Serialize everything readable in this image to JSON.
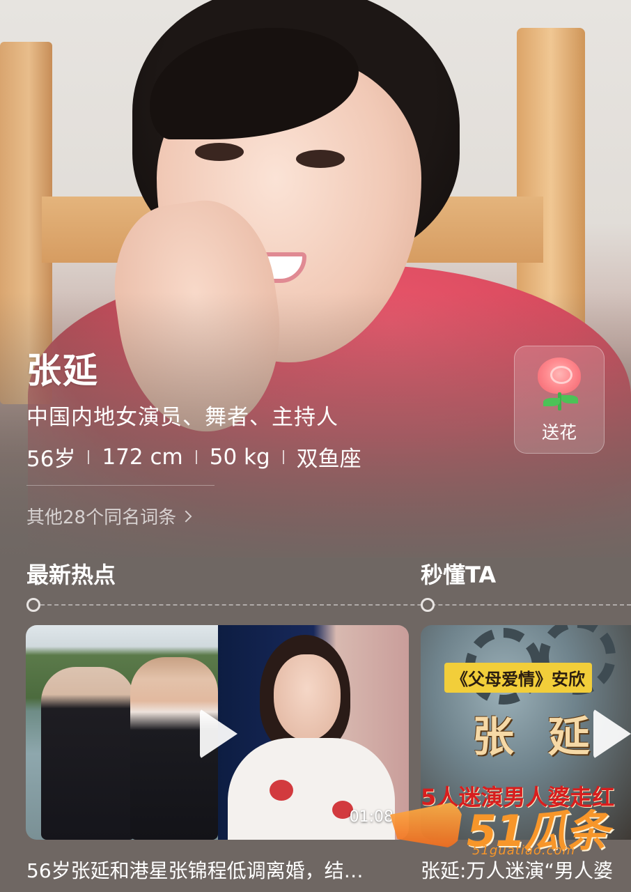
{
  "profile": {
    "name": "张延",
    "occupation": "中国内地女演员、舞者、主持人",
    "stats": [
      "56岁",
      "172 cm",
      "50 kg",
      "双鱼座"
    ],
    "same_name_link": "其他28个同名词条"
  },
  "actions": {
    "flower_label": "送花",
    "flower_icon": "rose-icon"
  },
  "sections": {
    "latest": "最新热点",
    "quick": "秒懂TA"
  },
  "cards": [
    {
      "duration": "01:08",
      "caption": "56岁张延和港星张锦程低调离婚，结…"
    },
    {
      "tag": "《父母爱情》安欣",
      "big_name": "张 延",
      "banner": "5人迷演男人婆走红",
      "caption": "张延:万人迷演“男人婆"
    }
  ],
  "watermark": {
    "brand": "51瓜条",
    "url": "51guatiao.com"
  },
  "colors": {
    "background": "#6f6763",
    "tag_yellow": "#f2ce3a",
    "watermark_orange": "#f7962a"
  }
}
